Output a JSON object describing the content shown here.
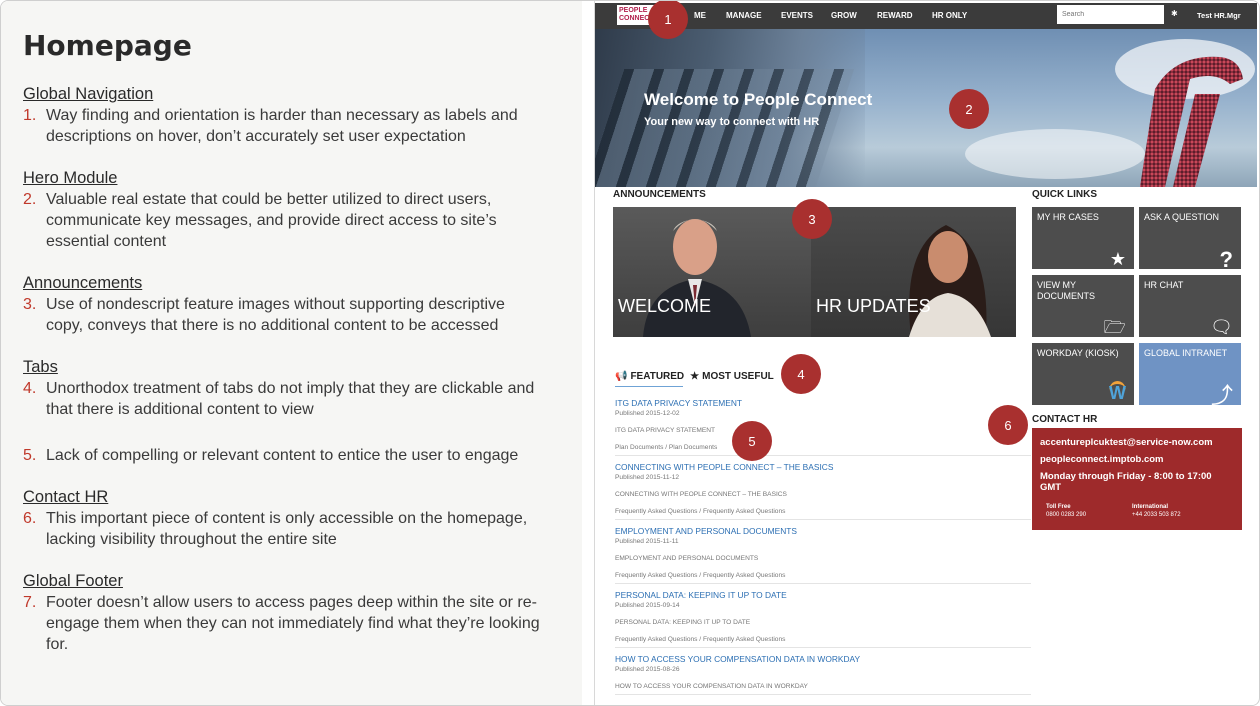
{
  "left": {
    "title": "Homepage",
    "sections": [
      {
        "heading": "Global Navigation",
        "items": [
          {
            "num": "1.",
            "text": "Way finding and orientation is harder than necessary as labels and descriptions on hover, don’t accurately set user expectation"
          }
        ]
      },
      {
        "heading": "Hero Module",
        "items": [
          {
            "num": "2.",
            "text": "Valuable real estate that could be better utilized to direct users, communicate key messages, and provide direct access to site’s essential content"
          }
        ]
      },
      {
        "heading": "Announcements",
        "items": [
          {
            "num": "3.",
            "text": "Use of nondescript feature images without supporting descriptive copy, conveys that there is no additional content to be accessed"
          }
        ]
      },
      {
        "heading": "Tabs",
        "items": [
          {
            "num": "4.",
            "text": "Unorthodox treatment of tabs do not imply that they are clickable and that there is additional content to view"
          },
          {
            "num": "5.",
            "text": "Lack of compelling or relevant content to entice the user to engage"
          }
        ]
      },
      {
        "heading": "Contact HR",
        "items": [
          {
            "num": "6.",
            "text": "This important piece of content is only accessible on the homepage, lacking visibility throughout the entire site"
          }
        ]
      },
      {
        "heading": "Global Footer",
        "items": [
          {
            "num": "7.",
            "text": "Footer doesn’t allow users to access pages deep within the site or re-engage them when they can not immediately find what they’re looking for."
          }
        ]
      }
    ]
  },
  "site": {
    "logo": "PEOPLE CONNECT",
    "nav": [
      "ME",
      "MANAGE",
      "EVENTS",
      "GROW",
      "REWARD",
      "HR ONLY"
    ],
    "search_placeholder": "Search",
    "user": "Test HR.Mgr",
    "hero": {
      "title": "Welcome to People Connect",
      "subtitle": "Your new way to connect with HR"
    },
    "announcements_heading": "ANNOUNCEMENTS",
    "announcements": [
      {
        "label": "WELCOME"
      },
      {
        "label": "HR UPDATES"
      }
    ],
    "tabs": [
      {
        "icon": "megaphone-icon",
        "glyph": "📢",
        "label": "FEATURED"
      },
      {
        "icon": "star-icon",
        "glyph": "★",
        "label": "MOST USEFUL"
      }
    ],
    "feed": [
      {
        "title": "ITG DATA PRIVACY STATEMENT",
        "date": "Published 2015-12-02",
        "desc": "ITG DATA PRIVACY STATEMENT",
        "cat": "Plan Documents / Plan Documents"
      },
      {
        "title": "CONNECTING WITH PEOPLE CONNECT – THE BASICS",
        "date": "Published 2015-11-12",
        "desc": "CONNECTING WITH PEOPLE CONNECT – THE BASICS",
        "cat": "Frequently Asked Questions / Frequently Asked Questions"
      },
      {
        "title": "EMPLOYMENT AND PERSONAL DOCUMENTS",
        "date": "Published 2015-11-11",
        "desc": "EMPLOYMENT AND PERSONAL DOCUMENTS",
        "cat": "Frequently Asked Questions / Frequently Asked Questions"
      },
      {
        "title": "PERSONAL DATA: KEEPING IT UP TO DATE",
        "date": "Published 2015-09-14",
        "desc": "PERSONAL DATA: KEEPING IT UP TO DATE",
        "cat": "Frequently Asked Questions / Frequently Asked Questions"
      },
      {
        "title": "HOW TO ACCESS YOUR COMPENSATION DATA IN WORKDAY",
        "date": "Published 2015-08-26",
        "desc": "HOW TO ACCESS YOUR COMPENSATION DATA IN WORKDAY",
        "cat": ""
      }
    ],
    "quick_links_heading": "QUICK LINKS",
    "quick_links": [
      {
        "label": "MY HR CASES",
        "icon": "star-icon",
        "glyph": "★"
      },
      {
        "label": "ASK A QUESTION",
        "icon": "question-icon",
        "glyph": "?"
      },
      {
        "label": "VIEW MY DOCUMENTS",
        "icon": "folder-icon",
        "glyph": "🗁"
      },
      {
        "label": "HR CHAT",
        "icon": "chat-icon",
        "glyph": "🗨"
      },
      {
        "label": "WORKDAY (KIOSK)",
        "icon": "workday-icon",
        "glyph": "W"
      },
      {
        "label": "GLOBAL INTRANET",
        "icon": "intranet-logo-icon",
        "glyph": "⤴"
      }
    ],
    "contact_heading": "CONTACT HR",
    "contact": {
      "email": "accentureplcuktest@service-now.com",
      "site": "peopleconnect.imptob.com",
      "hours": "Monday through Friday - 8:00 to 17:00 GMT",
      "toll_free_label": "Toll Free",
      "toll_free": "0800 0283 290",
      "intl_label": "International",
      "intl": "+44 2033 503 872"
    }
  },
  "markers": [
    "1",
    "2",
    "3",
    "4",
    "5",
    "6"
  ],
  "colors": {
    "accent": "#a9302f",
    "nav_bg": "#3b3b3b",
    "tile_bg": "#4d4d4d",
    "contact_bg": "#9e2a2b",
    "link": "#2c6fb3"
  }
}
